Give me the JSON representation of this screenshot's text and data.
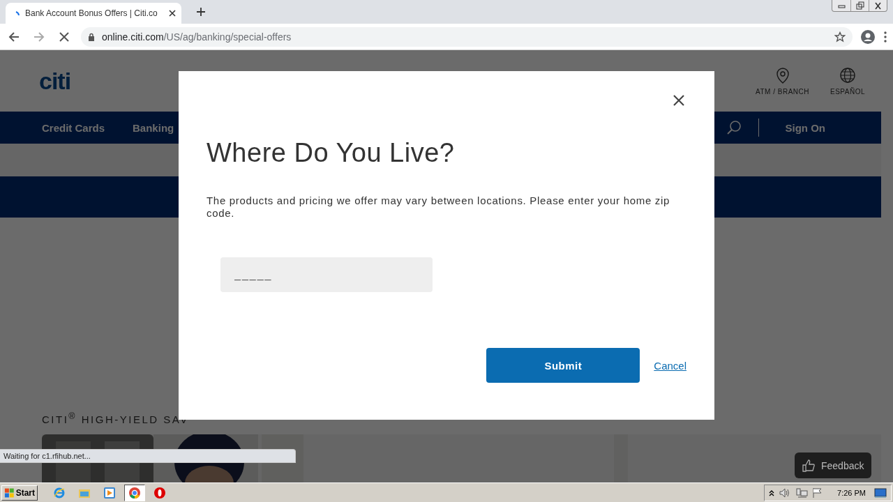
{
  "browser": {
    "tab": {
      "title": "Bank Account Bonus Offers | Citi.co",
      "loading": true
    },
    "address": {
      "host": "online.citi.com",
      "path": "/US/ag/banking/special-offers"
    }
  },
  "page": {
    "logo": "citi",
    "utilities": [
      {
        "kind": "pin",
        "label": "ATM / BRANCH"
      },
      {
        "kind": "globe",
        "label": "ESPAÑOL"
      }
    ],
    "nav": [
      "Credit Cards",
      "Banking"
    ],
    "sign_on": "Sign On",
    "section_title": "CITI$^{®}$ HIGH-YIELD SAV",
    "feedback": "Feedback"
  },
  "modal": {
    "title": "Where Do You Live?",
    "text": "The products and pricing we offer may vary between locations. Please enter your home zip code.",
    "zip": {
      "placeholder": "_____"
    },
    "submit": "Submit",
    "cancel": "Cancel"
  },
  "status_text": "Waiting for c1.rfihub.net...",
  "taskbar": {
    "start": "Start",
    "apps": [
      {
        "kind": "ie",
        "selected": false
      },
      {
        "kind": "folder",
        "selected": false
      },
      {
        "kind": "media",
        "selected": false
      },
      {
        "kind": "chrome",
        "selected": true
      },
      {
        "kind": "opera",
        "selected": false
      }
    ],
    "clock": "7:26 PM"
  }
}
